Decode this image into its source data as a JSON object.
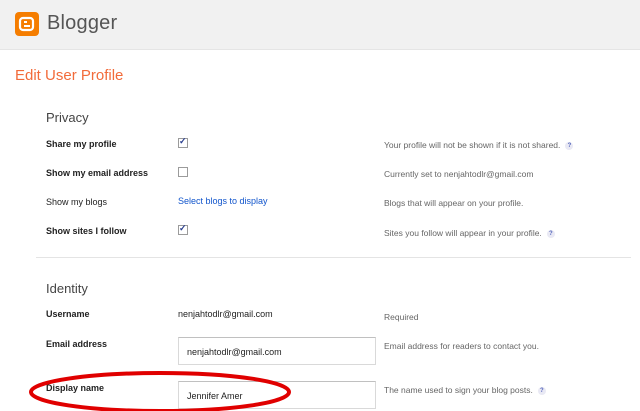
{
  "app": {
    "brand": "Blogger"
  },
  "page": {
    "title": "Edit User Profile"
  },
  "privacy": {
    "title": "Privacy",
    "rows": [
      {
        "label": "Share my profile",
        "checked": true,
        "help": "Your profile will not be shown if it is not shared.",
        "has_help_icon": true
      },
      {
        "label": "Show my email address",
        "checked": false,
        "help": "Currently set to nenjahtodlr@gmail.com",
        "has_help_icon": false
      },
      {
        "label": "Show my blogs",
        "link": "Select blogs to display",
        "help": "Blogs that will appear on your profile.",
        "has_help_icon": false
      },
      {
        "label": "Show sites I follow",
        "checked": true,
        "help": "Sites you follow will appear in your profile.",
        "has_help_icon": true
      }
    ]
  },
  "identity": {
    "title": "Identity",
    "username": {
      "label": "Username",
      "value": "nenjahtodlr@gmail.com",
      "help": "Required"
    },
    "email": {
      "label": "Email address",
      "value": "nenjahtodlr@gmail.com",
      "help": "Email address for readers to contact you."
    },
    "display_name": {
      "label": "Display name",
      "value": "Jennifer Amer",
      "help": "The name used to sign your blog posts."
    }
  },
  "help_icon_glyph": "?",
  "colors": {
    "brand_orange": "#f57d00",
    "title_orange": "#f26b3a",
    "link_blue": "#1155cc",
    "annotation_red": "#e00000"
  },
  "icons": {
    "logo": "blogger-logo-icon",
    "help": "help-question-icon"
  }
}
